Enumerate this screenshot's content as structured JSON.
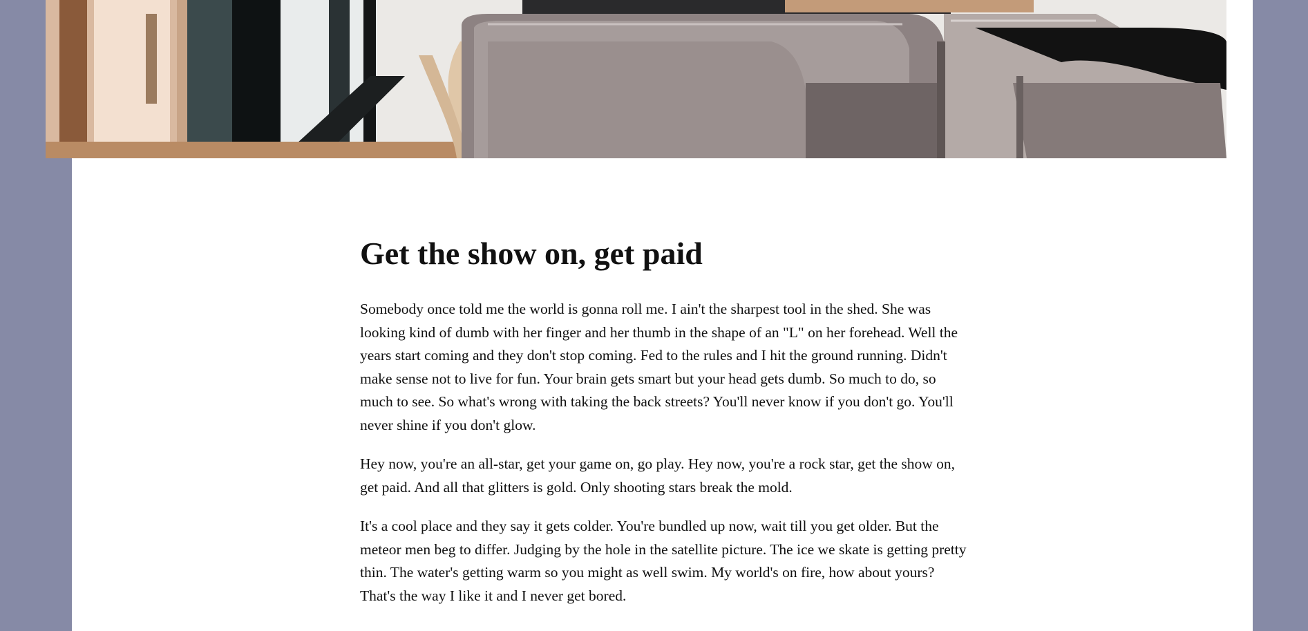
{
  "hero_image": {
    "alt": "",
    "icon": "photo-lounge-sofa"
  },
  "article": {
    "title": "Get the show on, get paid",
    "paragraphs": [
      "Somebody once told me the world is gonna roll me. I ain't the sharpest tool in the shed. She was looking kind of dumb with her finger and her thumb in the shape of an \"L\" on her forehead. Well the years start coming and they don't stop coming. Fed to the rules and I hit the ground running. Didn't make sense not to live for fun. Your brain gets smart but your head gets dumb. So much to do, so much to see. So what's wrong with taking the back streets? You'll never know if you don't go. You'll never shine if you don't glow.",
      "Hey now, you're an all-star, get your game on, go play. Hey now, you're a rock star, get the show on, get paid. And all that glitters is gold. Only shooting stars break the mold.",
      "It's a cool place and they say it gets colder. You're bundled up now, wait till you get older. But the meteor men beg to differ. Judging by the hole in the satellite picture. The ice we skate is getting pretty thin. The water's getting warm so you might as well swim. My world's on fire, how about yours? That's the way I like it and I never get bored."
    ]
  },
  "colors": {
    "background": "#868aa6",
    "page": "#ffffff",
    "text": "#111111"
  }
}
